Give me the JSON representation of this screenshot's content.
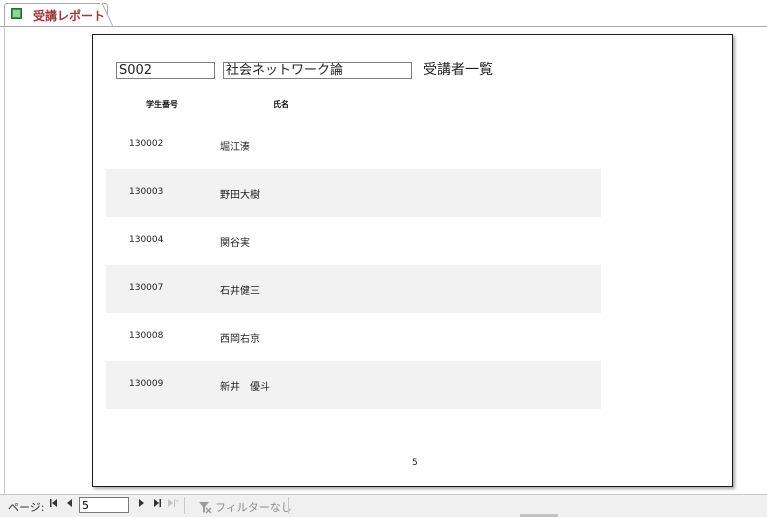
{
  "tab": {
    "title": "受講レポート",
    "icon": "report-icon"
  },
  "report": {
    "course_code": "S002",
    "course_name": "社会ネットワーク論",
    "suffix": "受講者一覧",
    "columns": {
      "student_id": "学生番号",
      "name": "氏名"
    },
    "rows": [
      {
        "student_id": "130002",
        "name": "堀江湊"
      },
      {
        "student_id": "130003",
        "name": "野田大樹"
      },
      {
        "student_id": "130004",
        "name": "関谷実"
      },
      {
        "student_id": "130007",
        "name": "石井健三"
      },
      {
        "student_id": "130008",
        "name": "西岡右京"
      },
      {
        "student_id": "130009",
        "name": "新井　優斗"
      }
    ],
    "page_number": "5"
  },
  "navigation": {
    "page_label": "ページ:",
    "current_page": "5",
    "first_icon": "first-page-icon",
    "prev_icon": "previous-page-icon",
    "next_icon": "next-page-icon",
    "last_icon": "last-page-icon",
    "new_icon": "new-record-icon",
    "filter_label": "フィルターなし",
    "filter_icon": "no-filter-icon"
  },
  "colors": {
    "tab_title": "#a4373a",
    "row_alt": "#f2f2f2",
    "workspace": "#ffffff"
  }
}
